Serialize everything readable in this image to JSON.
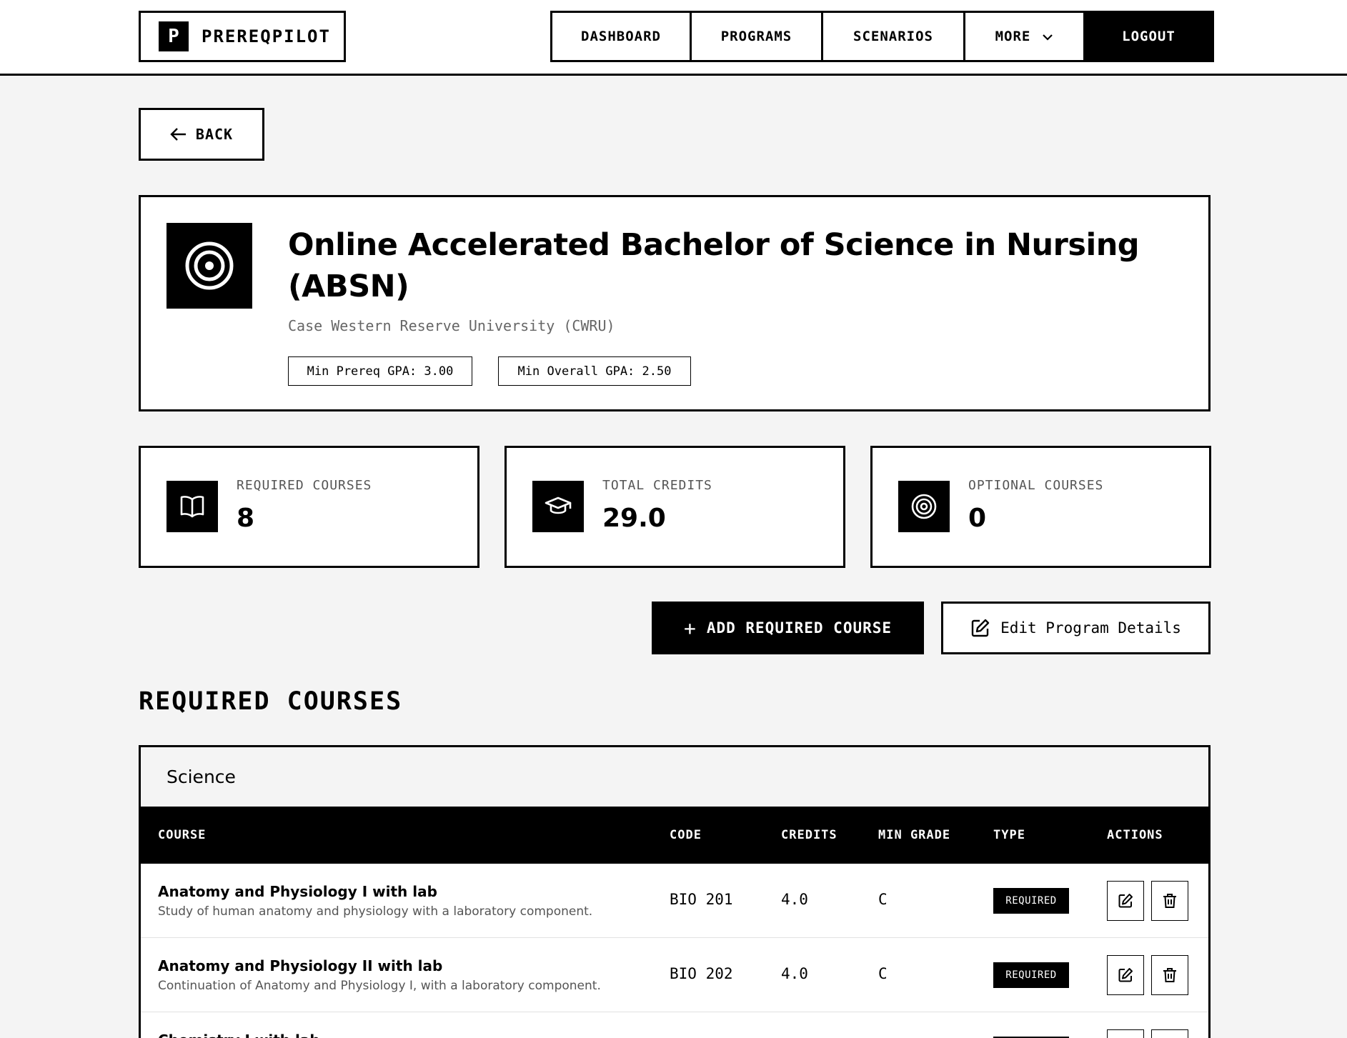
{
  "brand": {
    "name": "PREREQPILOT",
    "mark": "P"
  },
  "nav": {
    "dashboard": "DASHBOARD",
    "programs": "PROGRAMS",
    "scenarios": "SCENARIOS",
    "more": "MORE",
    "logout": "LOGOUT"
  },
  "back_label": "BACK",
  "program": {
    "title": "Online Accelerated Bachelor of Science in Nursing (ABSN)",
    "school": "Case Western Reserve University (CWRU)",
    "min_prereq_gpa": "Min Prereq GPA: 3.00",
    "min_overall_gpa": "Min Overall GPA: 2.50"
  },
  "stats": [
    {
      "label": "REQUIRED COURSES",
      "value": "8",
      "icon": "book-icon"
    },
    {
      "label": "TOTAL CREDITS",
      "value": "29.0",
      "icon": "graduation-cap-icon"
    },
    {
      "label": "OPTIONAL COURSES",
      "value": "0",
      "icon": "target-icon"
    }
  ],
  "actions": {
    "add_label": "ADD REQUIRED COURSE",
    "edit_label": "Edit Program Details"
  },
  "section_title": "REQUIRED COURSES",
  "group": {
    "name": "Science",
    "columns": [
      "COURSE",
      "CODE",
      "CREDITS",
      "MIN GRADE",
      "TYPE",
      "ACTIONS"
    ],
    "rows": [
      {
        "name": "Anatomy and Physiology I with lab",
        "description": "Study of human anatomy and physiology with a laboratory component.",
        "code": "BIO 201",
        "credits": "4.0",
        "min_grade": "C",
        "type": "REQUIRED"
      },
      {
        "name": "Anatomy and Physiology II with lab",
        "description": "Continuation of Anatomy and Physiology I, with a laboratory component.",
        "code": "BIO 202",
        "credits": "4.0",
        "min_grade": "C",
        "type": "REQUIRED"
      },
      {
        "name": "Chemistry I with lab",
        "description": "",
        "code": "",
        "credits": "",
        "min_grade": "",
        "type": "REQUIRED"
      }
    ]
  },
  "colors": {
    "primary": "#000000",
    "background": "#f4f4f4",
    "surface": "#ffffff",
    "muted": "#666666"
  }
}
